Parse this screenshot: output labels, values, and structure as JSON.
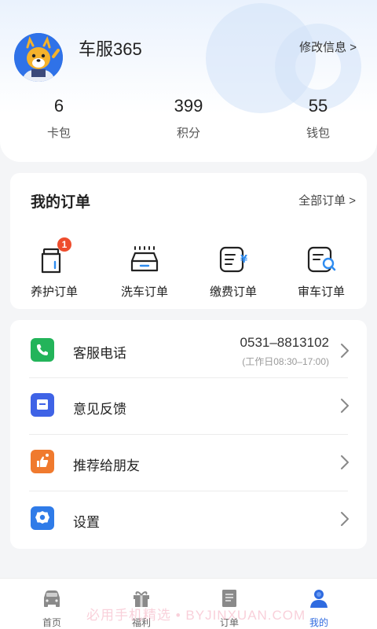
{
  "profile": {
    "username": "车服365",
    "edit_label": "修改信息 >"
  },
  "stats": [
    {
      "value": "6",
      "label": "卡包"
    },
    {
      "value": "399",
      "label": "积分"
    },
    {
      "value": "55",
      "label": "钱包"
    }
  ],
  "orders": {
    "title": "我的订单",
    "all_label": "全部订单 >",
    "items": [
      {
        "label": "养护订单",
        "icon": "maintenance-order-icon",
        "badge": "1"
      },
      {
        "label": "洗车订单",
        "icon": "car-wash-icon"
      },
      {
        "label": "缴费订单",
        "icon": "payment-order-icon"
      },
      {
        "label": "审车订单",
        "icon": "inspection-order-icon"
      }
    ]
  },
  "menu": {
    "items": [
      {
        "label": "客服电话",
        "icon": "phone-icon",
        "color": "#23b45a",
        "phone": "0531–8813102",
        "hours": "(工作日08:30–17:00)"
      },
      {
        "label": "意见反馈",
        "icon": "feedback-icon",
        "color": "#3f63e6"
      },
      {
        "label": "推荐给朋友",
        "icon": "recommend-icon",
        "color": "#f07a2e"
      },
      {
        "label": "设置",
        "icon": "settings-icon",
        "color": "#2f7be8"
      }
    ]
  },
  "tabbar": {
    "tabs": [
      {
        "label": "首页",
        "icon": "car-icon"
      },
      {
        "label": "福利",
        "icon": "gift-icon"
      },
      {
        "label": "订单",
        "icon": "order-list-icon"
      },
      {
        "label": "我的",
        "icon": "user-icon",
        "active": true
      }
    ]
  },
  "watermark": "必用手机精选 • BYJINXUAN.COM",
  "colors": {
    "accent": "#2f6be0",
    "badge": "#ee4d2d"
  }
}
